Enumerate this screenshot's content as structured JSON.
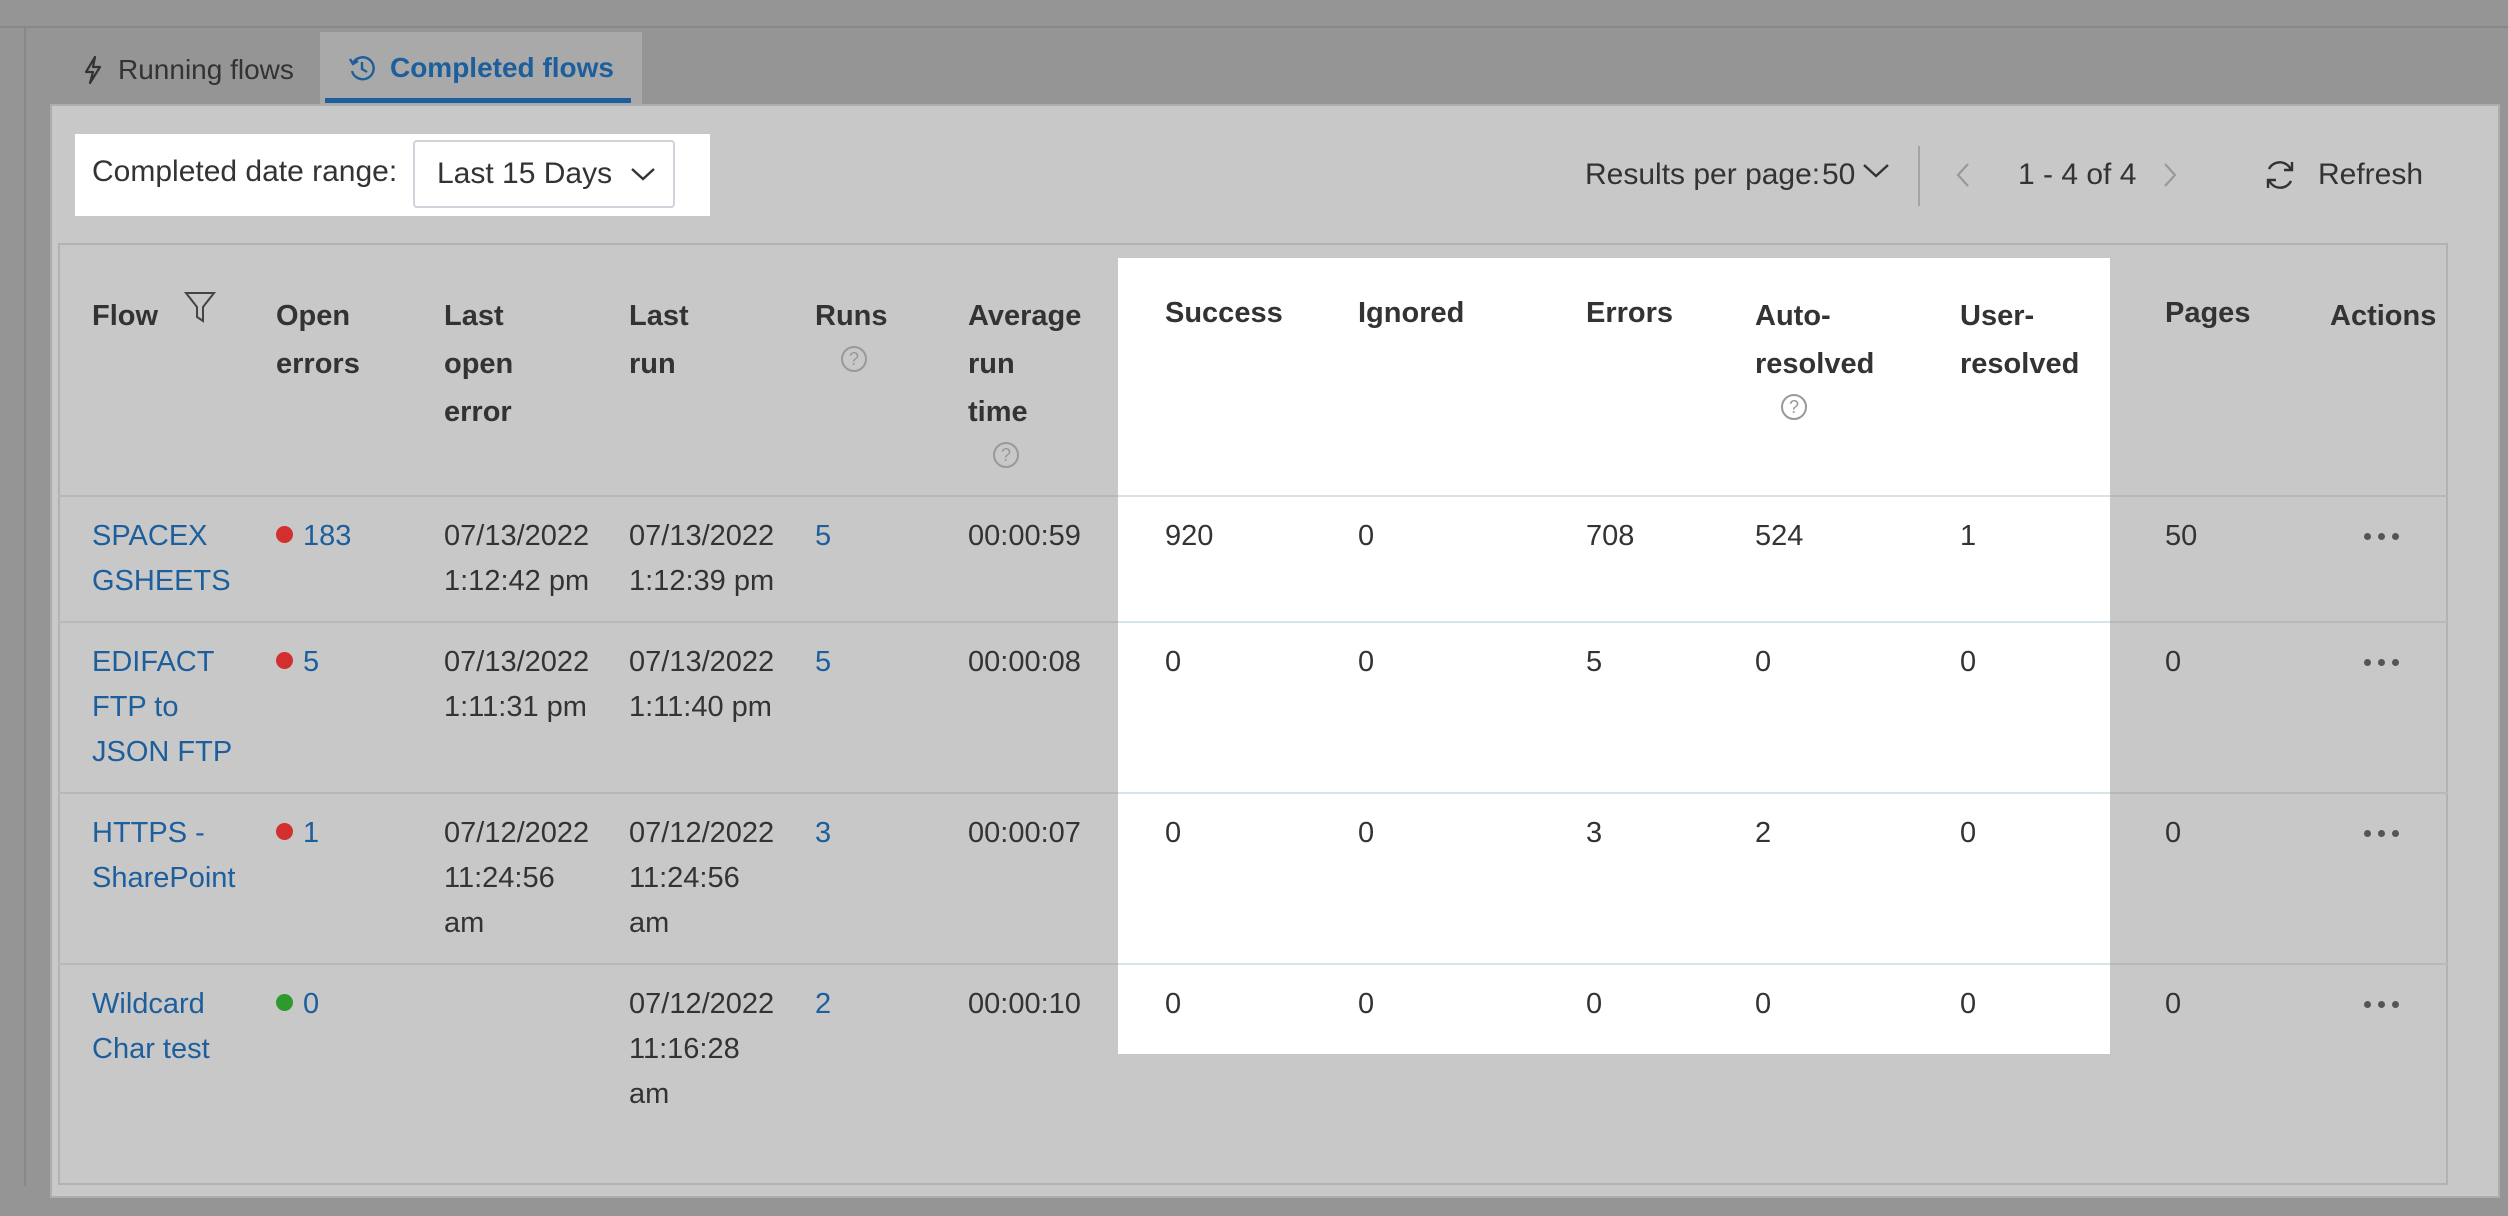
{
  "tabs": {
    "running": "Running flows",
    "completed": "Completed flows"
  },
  "toolbar": {
    "date_range_label": "Completed date range:",
    "date_range_value": "Last 15 Days",
    "results_per_page_label": "Results per page:",
    "results_per_page_value": "50",
    "page_range": "1 - 4 of 4",
    "refresh_label": "Refresh"
  },
  "columns": {
    "flow": "Flow",
    "open_errors_1": "Open",
    "open_errors_2": "errors",
    "last_open_error_1": "Last",
    "last_open_error_2": "open",
    "last_open_error_3": "error",
    "last_run_1": "Last",
    "last_run_2": "run",
    "runs": "Runs",
    "avg_run_time_1": "Average",
    "avg_run_time_2": "run",
    "avg_run_time_3": "time",
    "success": "Success",
    "ignored": "Ignored",
    "errors": "Errors",
    "auto_resolved_1": "Auto-",
    "auto_resolved_2": "resolved",
    "user_resolved_1": "User-",
    "user_resolved_2": "resolved",
    "pages": "Pages",
    "actions": "Actions"
  },
  "rows": [
    {
      "flow": [
        "SPACEX",
        "GSHEETS"
      ],
      "open_errors": "183",
      "status_color": "#d32f2f",
      "last_open_error": [
        "07/13/2022",
        "1:12:42 pm"
      ],
      "last_run": [
        "07/13/2022",
        "1:12:39 pm"
      ],
      "runs": "5",
      "avg_run_time": "00:00:59",
      "success": "920",
      "ignored": "0",
      "errors": "708",
      "auto_resolved": "524",
      "user_resolved": "1",
      "pages": "50"
    },
    {
      "flow": [
        "EDIFACT",
        "FTP to",
        "JSON FTP"
      ],
      "open_errors": "5",
      "status_color": "#d32f2f",
      "last_open_error": [
        "07/13/2022",
        "1:11:31 pm"
      ],
      "last_run": [
        "07/13/2022",
        "1:11:40 pm"
      ],
      "runs": "5",
      "avg_run_time": "00:00:08",
      "success": "0",
      "ignored": "0",
      "errors": "5",
      "auto_resolved": "0",
      "user_resolved": "0",
      "pages": "0"
    },
    {
      "flow": [
        "HTTPS -",
        "SharePoint"
      ],
      "open_errors": "1",
      "status_color": "#d32f2f",
      "last_open_error": [
        "07/12/2022",
        "11:24:56",
        "am"
      ],
      "last_run": [
        "07/12/2022",
        "11:24:56",
        "am"
      ],
      "runs": "3",
      "avg_run_time": "00:00:07",
      "success": "0",
      "ignored": "0",
      "errors": "3",
      "auto_resolved": "2",
      "user_resolved": "0",
      "pages": "0"
    },
    {
      "flow": [
        "Wildcard",
        "Char test"
      ],
      "open_errors": "0",
      "status_color": "#2e9a2e",
      "last_open_error": [],
      "last_run": [
        "07/12/2022",
        "11:16:28",
        "am"
      ],
      "runs": "2",
      "avg_run_time": "00:00:10",
      "success": "0",
      "ignored": "0",
      "errors": "0",
      "auto_resolved": "0",
      "user_resolved": "0",
      "pages": "0"
    }
  ],
  "colors": {
    "link": "#1d5e9c",
    "error_dot": "#d32f2f",
    "ok_dot": "#2e9a2e",
    "overlay_gray": "#c8c8c8",
    "highlight": "#ffffff"
  }
}
